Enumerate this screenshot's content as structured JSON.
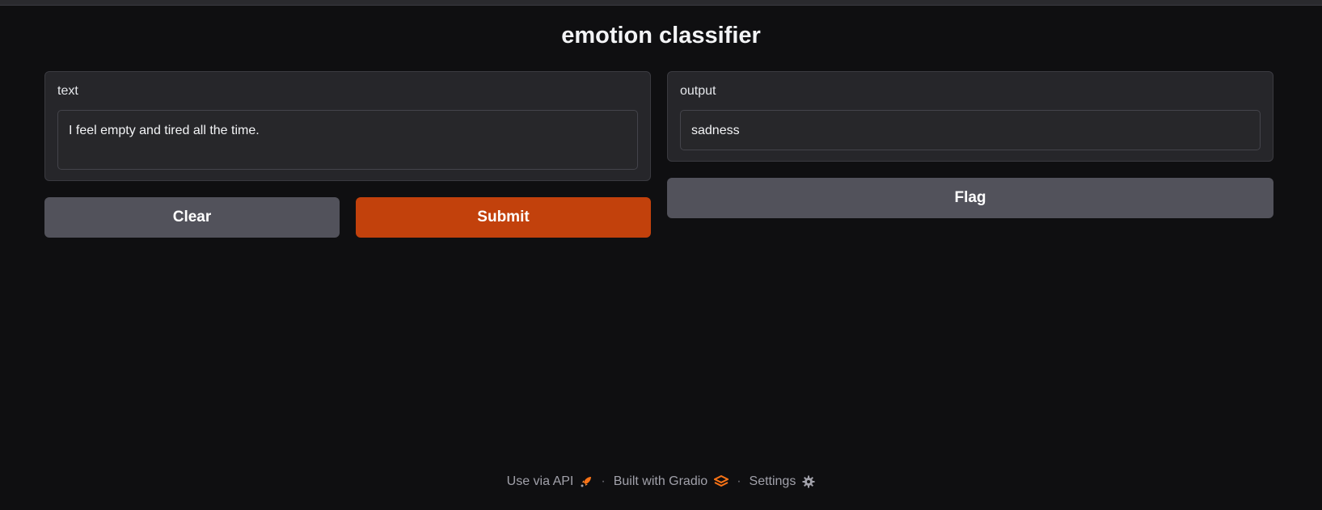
{
  "app": {
    "title": "emotion classifier"
  },
  "input_panel": {
    "label": "text",
    "value": "I feel empty and tired all the time."
  },
  "output_panel": {
    "label": "output",
    "value": "sadness"
  },
  "buttons": {
    "clear": "Clear",
    "submit": "Submit",
    "flag": "Flag"
  },
  "footer": {
    "api": "Use via API",
    "built": "Built with Gradio",
    "settings": "Settings",
    "separator": "·"
  },
  "icons": {
    "api": "rocket-icon",
    "gradio": "gradio-logo-icon",
    "settings": "gear-icon"
  },
  "colors": {
    "background": "#0f0f11",
    "primary_button": "#c2410c",
    "secondary_button": "#52525b",
    "accent": "#f97316"
  }
}
